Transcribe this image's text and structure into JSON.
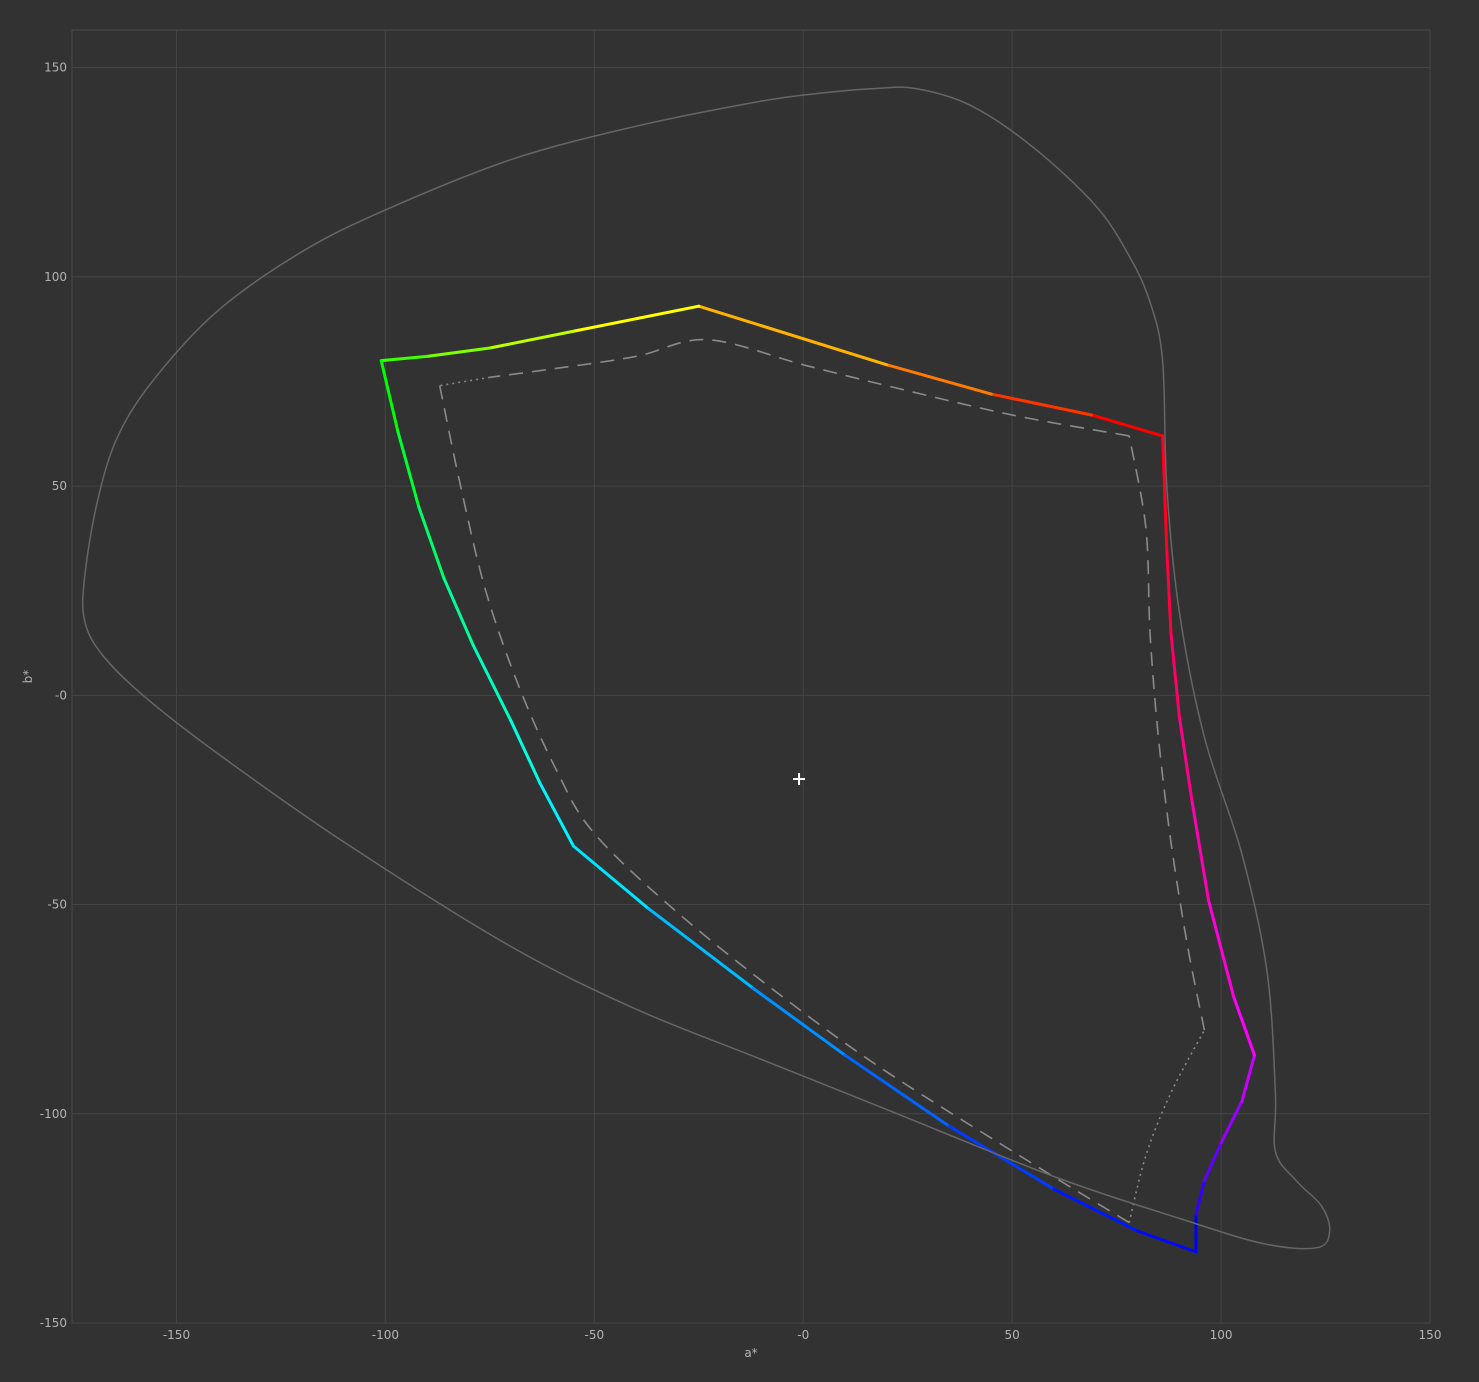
{
  "chart_data": {
    "type": "line",
    "title": "",
    "xlabel": "a*",
    "ylabel": "b*",
    "xlim": [
      -175,
      150
    ],
    "ylim": [
      -150,
      159
    ],
    "x_ticks": [
      -150,
      -100,
      -50,
      0,
      50,
      100,
      150
    ],
    "y_ticks": [
      -150,
      -100,
      -50,
      0,
      50,
      100,
      150
    ],
    "x_tick_labels": [
      "-150",
      "-100",
      "-50",
      "-0",
      "50",
      "100",
      "150"
    ],
    "y_tick_labels": [
      "-150",
      "-100",
      "-50",
      "-0",
      "50",
      "100",
      "150"
    ],
    "grid": true,
    "colors": {
      "background": "#323232",
      "grid": "#444444",
      "frame": "#4a4a4a",
      "text": "#b4b4b4",
      "outline": "#666666",
      "reference": "#8a8a8a"
    },
    "series": [
      {
        "style": "gradient-solid",
        "closed": true,
        "points": [
          [
            86,
            62
          ],
          [
            69,
            67
          ],
          [
            45,
            72
          ],
          [
            20,
            79
          ],
          [
            -25,
            93
          ],
          [
            -55,
            87
          ],
          [
            -75,
            83
          ],
          [
            -90,
            81
          ],
          [
            -101,
            80
          ],
          [
            -97,
            63
          ],
          [
            -92,
            45
          ],
          [
            -86,
            28
          ],
          [
            -79,
            12
          ],
          [
            -70,
            -6
          ],
          [
            -63,
            -21
          ],
          [
            -55,
            -36
          ],
          [
            -37,
            -51
          ],
          [
            -12,
            -70
          ],
          [
            10,
            -86
          ],
          [
            35,
            -103
          ],
          [
            60,
            -118
          ],
          [
            80,
            -128
          ],
          [
            94,
            -133
          ],
          [
            94,
            -124
          ],
          [
            96,
            -116
          ],
          [
            100,
            -107
          ],
          [
            105,
            -97
          ],
          [
            108,
            -86
          ],
          [
            103,
            -72
          ],
          [
            97,
            -49
          ],
          [
            93,
            -25
          ],
          [
            90,
            -5
          ],
          [
            88,
            15
          ],
          [
            87,
            35
          ],
          [
            86,
            62
          ]
        ],
        "point_colors": [
          "#ff0000",
          "#ff3500",
          "#ff7a00",
          "#ffb300",
          "#ffff00",
          "#c0ff00",
          "#80ff00",
          "#40ff00",
          "#00ff00",
          "#00ff2e",
          "#00ff66",
          "#00ff96",
          "#00ffbe",
          "#00ffe0",
          "#00f5ff",
          "#00e5ff",
          "#00bbff",
          "#008fff",
          "#0064ff",
          "#003cff",
          "#0018ff",
          "#0008ff",
          "#0000ff",
          "#3200ff",
          "#6000ff",
          "#9600ff",
          "#c800ff",
          "#ff00ff",
          "#ff00dc",
          "#ff00b4",
          "#ff008c",
          "#ff0064",
          "#ff0041",
          "#ff0021",
          "#ff0000"
        ]
      },
      {
        "style": "dashed",
        "points": [
          [
            -87,
            74
          ],
          [
            -82,
            50
          ],
          [
            -76,
            25
          ],
          [
            -68,
            2
          ],
          [
            -59,
            -18
          ],
          [
            -50,
            -33
          ],
          [
            -30,
            -52
          ],
          [
            -5,
            -72
          ],
          [
            20,
            -90
          ],
          [
            55,
            -112
          ],
          [
            78,
            -126
          ]
        ]
      },
      {
        "style": "dotted",
        "points": [
          [
            78,
            -126
          ],
          [
            82,
            -110
          ],
          [
            88,
            -95
          ],
          [
            96,
            -80
          ]
        ]
      },
      {
        "style": "dashed",
        "points": [
          [
            96,
            -80
          ],
          [
            92,
            -60
          ],
          [
            88,
            -35
          ],
          [
            85,
            -10
          ],
          [
            83,
            15
          ],
          [
            82,
            40
          ],
          [
            78,
            62
          ]
        ]
      },
      {
        "style": "dashed",
        "points": [
          [
            78,
            62
          ],
          [
            50,
            67
          ],
          [
            20,
            74
          ],
          [
            0,
            79
          ],
          [
            -23,
            85
          ],
          [
            -40,
            81
          ],
          [
            -60,
            78
          ],
          [
            -75,
            76
          ]
        ]
      },
      {
        "style": "dotted",
        "points": [
          [
            -75,
            76
          ],
          [
            -87,
            74
          ]
        ]
      },
      {
        "style": "outline",
        "closed": true,
        "points": [
          [
            17,
            145
          ],
          [
            5,
            144
          ],
          [
            -10,
            142
          ],
          [
            -40,
            136
          ],
          [
            -70,
            128
          ],
          [
            -100,
            116
          ],
          [
            -120,
            106
          ],
          [
            -140,
            92
          ],
          [
            -155,
            76
          ],
          [
            -164,
            62
          ],
          [
            -169,
            46
          ],
          [
            -172,
            28
          ],
          [
            -172,
            18
          ],
          [
            -168,
            10
          ],
          [
            -158,
            0
          ],
          [
            -140,
            -14
          ],
          [
            -110,
            -35
          ],
          [
            -70,
            -60
          ],
          [
            -40,
            -75
          ],
          [
            -10,
            -87
          ],
          [
            20,
            -99
          ],
          [
            60,
            -115
          ],
          [
            90,
            -125
          ],
          [
            110,
            -131
          ],
          [
            123,
            -132
          ],
          [
            126,
            -128
          ],
          [
            124,
            -122
          ],
          [
            118,
            -116
          ],
          [
            113,
            -109
          ],
          [
            113,
            -95
          ],
          [
            111,
            -66
          ],
          [
            105,
            -38
          ],
          [
            96,
            -10
          ],
          [
            90,
            20
          ],
          [
            87,
            50
          ],
          [
            86,
            80
          ],
          [
            83,
            94
          ],
          [
            78,
            105
          ],
          [
            70,
            117
          ],
          [
            55,
            131
          ],
          [
            40,
            141
          ],
          [
            27,
            145
          ],
          [
            17,
            145
          ]
        ]
      }
    ],
    "annotations": [
      {
        "symbol": "+",
        "x": -1,
        "y": -20
      }
    ]
  }
}
